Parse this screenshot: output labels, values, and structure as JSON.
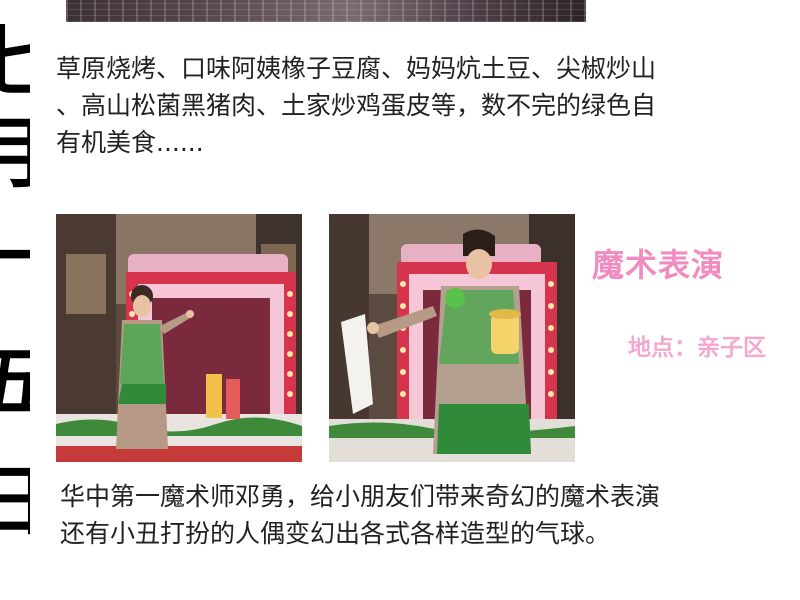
{
  "side_title": [
    "七",
    "月",
    "一",
    "五",
    "日"
  ],
  "food_paragraph": {
    "lines": [
      "草原烧烤、口味阿姨橡子豆腐、妈妈炕土豆、尖椒炒山",
      "、高山松菌黑猪肉、土家炒鸡蛋皮等，数不完的绿色自",
      "有机美食......"
    ]
  },
  "magic_section": {
    "title": "魔术表演",
    "venue": "地点：亲子区"
  },
  "magic_paragraph": {
    "lines": [
      "华中第一魔术师邓勇，给小朋友们带来奇幻的魔术表演",
      "还有小丑打扮的人偶变幻出各式各样造型的气球。"
    ]
  },
  "colors": {
    "accent_pink": "#f08cc0",
    "venue_pink": "#f2a8cf",
    "stage_red": "#d6334d",
    "costume_green": "#3fa84a"
  }
}
